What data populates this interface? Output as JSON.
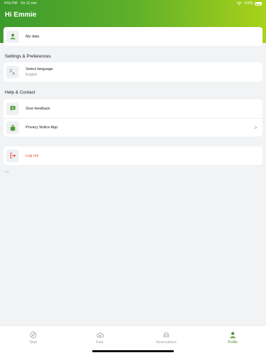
{
  "status": {
    "time": "4:51 PM",
    "date": "Do 12 mei",
    "battery": "100%"
  },
  "greeting": "Hi Emmie",
  "account": {
    "my_data": "My data"
  },
  "settings": {
    "title": "Settings & Preferences",
    "language_label": "Select language",
    "language_value": "English"
  },
  "help": {
    "title": "Help & Contact",
    "feedback": "Give feedback",
    "privacy": "Privacy Notice App"
  },
  "logout": "Log out",
  "version": "v.1",
  "tabs": [
    {
      "label": "Start",
      "icon": "compass-icon"
    },
    {
      "label": "Park",
      "icon": "cloud-car-icon"
    },
    {
      "label": "Reservations",
      "icon": "car-icon"
    },
    {
      "label": "Profile",
      "icon": "person-icon",
      "active": true
    }
  ],
  "colors": {
    "accent": "#4a9a2e",
    "danger": "#e0443b",
    "header_start": "#3c9a2c",
    "header_end": "#a9d21a"
  }
}
